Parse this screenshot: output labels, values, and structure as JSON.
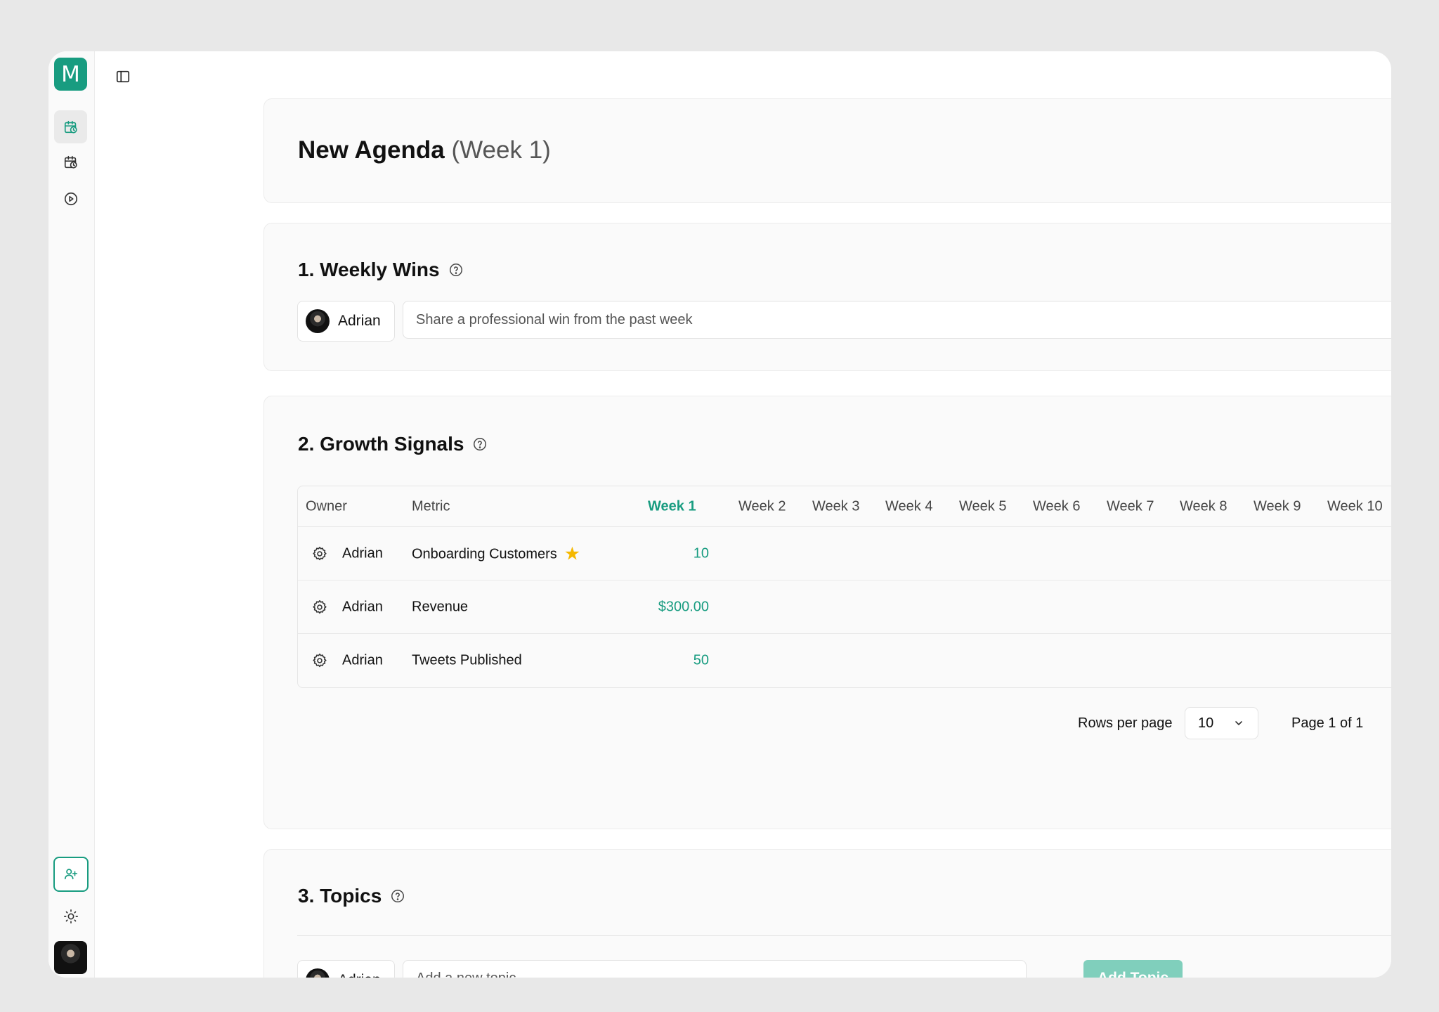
{
  "app": {
    "logo_letter": "M"
  },
  "page": {
    "title": "New Agenda",
    "subtitle": "(Week 1)"
  },
  "weekly_wins": {
    "title": "1. Weekly Wins",
    "owner": "Adrian",
    "placeholder": "Share a professional win from the past week"
  },
  "growth_signals": {
    "title": "2. Growth Signals",
    "columns": [
      "Owner",
      "Metric",
      "Week 1",
      "Week 2",
      "Week 3",
      "Week 4",
      "Week 5",
      "Week 6",
      "Week 7",
      "Week 8",
      "Week 9",
      "Week 10"
    ],
    "rows": [
      {
        "owner": "Adrian",
        "metric": "Onboarding Customers",
        "starred": true,
        "week1": "10"
      },
      {
        "owner": "Adrian",
        "metric": "Revenue",
        "starred": false,
        "week1": "$300.00"
      },
      {
        "owner": "Adrian",
        "metric": "Tweets Published",
        "starred": false,
        "week1": "50"
      }
    ],
    "pagination": {
      "rows_label": "Rows per page",
      "rows_value": "10",
      "page_info": "Page 1 of 1"
    }
  },
  "topics": {
    "title": "3. Topics",
    "owner": "Adrian",
    "placeholder": "Add a new topic...",
    "button": "Add Topic"
  },
  "colors": {
    "accent": "#189c80",
    "button_disabled": "#80cfbc",
    "star": "#f5b800"
  }
}
